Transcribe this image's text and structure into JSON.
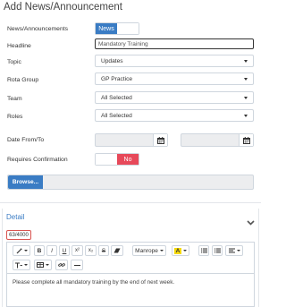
{
  "page": {
    "title": "Add News/Announcement"
  },
  "form": {
    "type": {
      "label": "News/Announcements",
      "toggle_on": "News"
    },
    "headline": {
      "label": "Headline",
      "value": "Mandatory Training"
    },
    "topic": {
      "label": "Topic",
      "value": "Updates"
    },
    "rota_group": {
      "label": "Rota Group",
      "value": "GP Practice"
    },
    "team": {
      "label": "Team",
      "value": "All Selected"
    },
    "roles": {
      "label": "Roles",
      "value": "All Selected"
    },
    "date": {
      "label": "Date From/To"
    },
    "confirmation": {
      "label": "Requires Confirmation",
      "value": "No"
    },
    "file": {
      "browse_label": "Browse..."
    }
  },
  "detail": {
    "title": "Detail",
    "char_counter": "63/4000",
    "toolbar": {
      "font_name": "Manrope",
      "bold": "B",
      "italic": "I",
      "underline": "U",
      "superscript": "x²",
      "subscript": "x₂",
      "strikethrough": "S",
      "text_color": "A"
    },
    "content": "Please complete all mandatory training by the end of next week."
  },
  "colors": {
    "accent": "#3a7cc4",
    "danger": "#e7495a",
    "highlight": "#f5d90a",
    "counter_border": "#d9534f"
  }
}
